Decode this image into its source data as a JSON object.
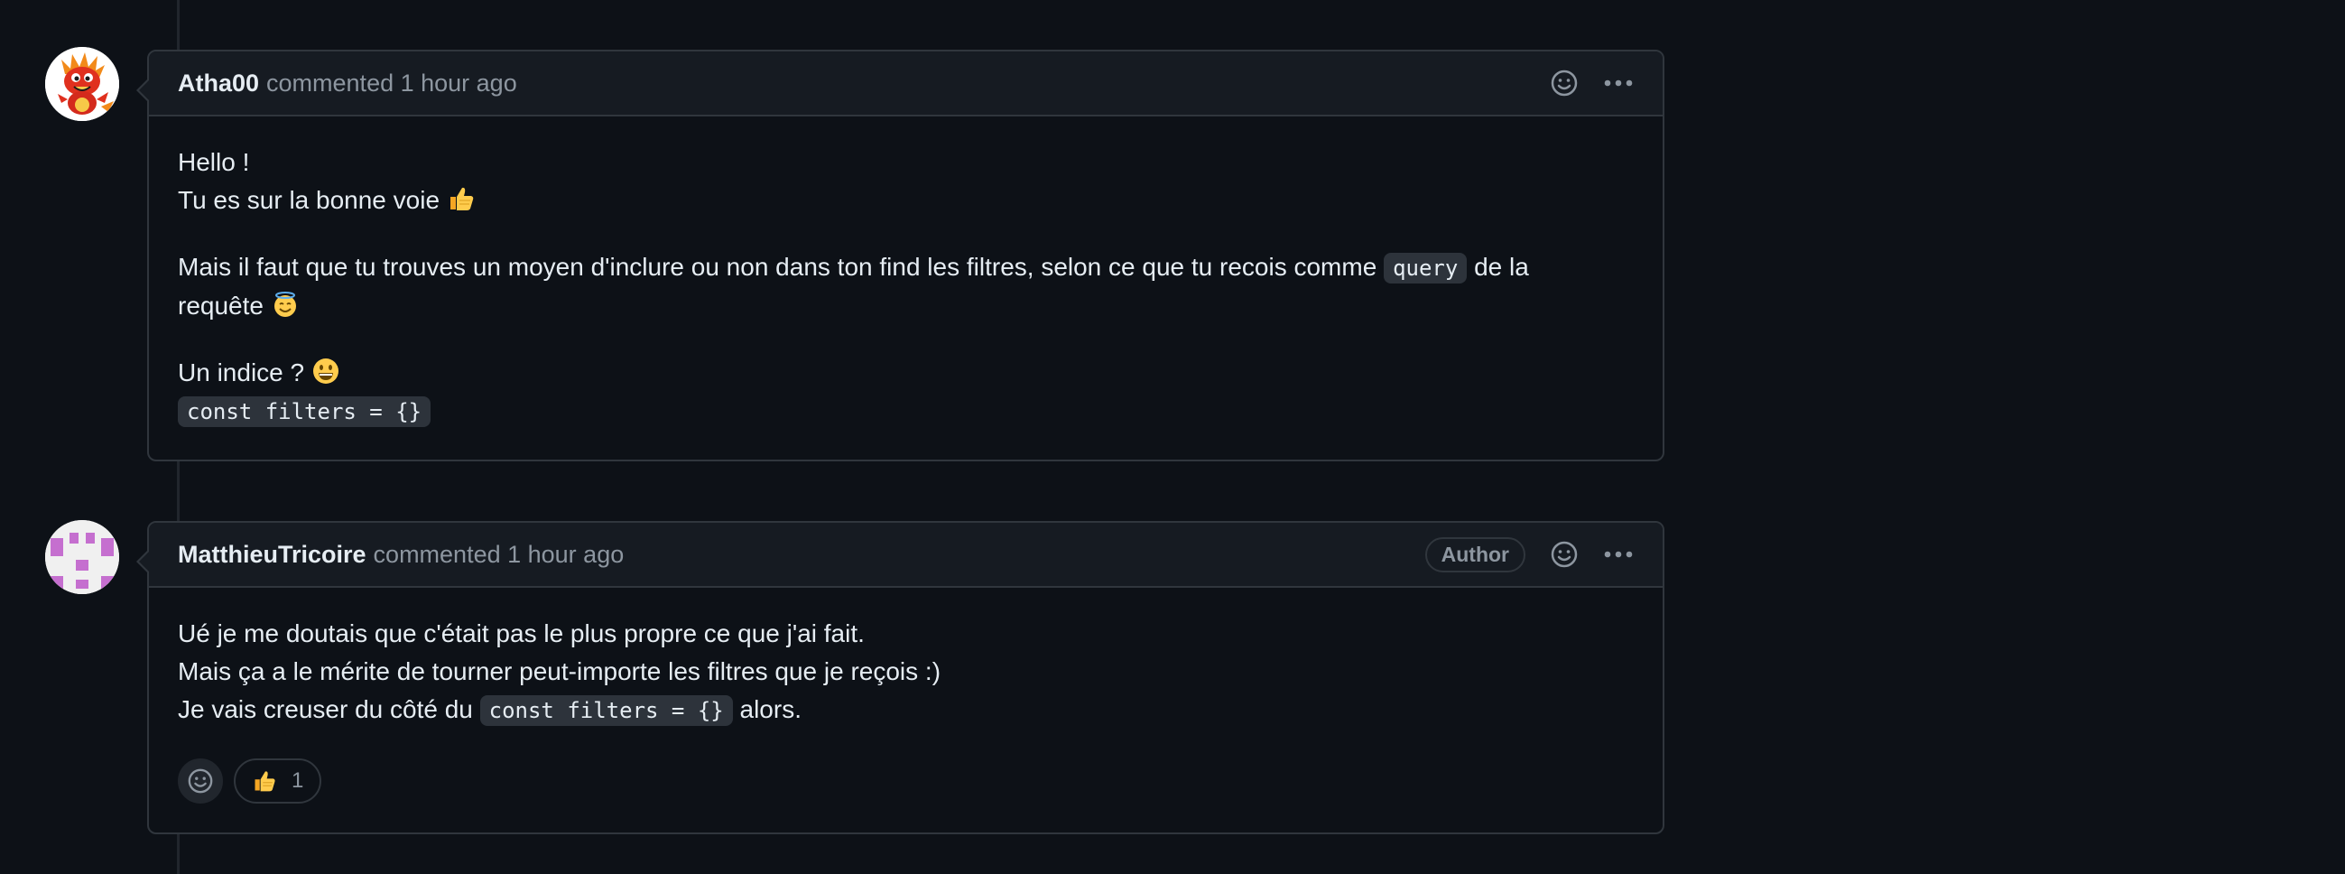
{
  "comments": [
    {
      "author": "Atha00",
      "meta": "commented 1 hour ago",
      "avatar_icon": "dragon-avatar",
      "body": {
        "line1": "Hello !",
        "line2": "Tu es sur la bonne voie",
        "line2_emoji": "thumbs-up-emoji",
        "para2_before": "Mais il faut que tu trouves un moyen d'inclure ou non dans ton find les filtres, selon ce que tu recois comme",
        "para2_code": "query",
        "para2_after": "de la",
        "para2_line2": "requête",
        "para2_emoji": "smiling-face-with-halo-emoji",
        "para3_line1": "Un indice ?",
        "para3_emoji": "grinning-face-emoji",
        "para3_code": "const filters = {}"
      },
      "actions": {
        "react_icon": "smiley-icon",
        "more_icon": "kebab-horizontal-icon"
      }
    },
    {
      "author": "MatthieuTricoire",
      "meta": "commented 1 hour ago",
      "badge": "Author",
      "avatar_icon": "identicon-avatar",
      "body": {
        "line1": "Ué je me doutais que c'était pas le plus propre ce que j'ai fait.",
        "line2": "Mais ça a le mérite de tourner peut-importe les filtres que je reçois :)",
        "line3_before": "Je vais creuser du côté du",
        "line3_code": "const filters = {}",
        "line3_after": "alors."
      },
      "actions": {
        "react_icon": "smiley-icon",
        "more_icon": "kebab-horizontal-icon"
      },
      "reactions": [
        {
          "emoji": "thumbs-up-emoji",
          "count": "1"
        }
      ]
    }
  ],
  "colors": {
    "background": "#0d1117",
    "header_bg": "#161b22",
    "border": "#30363d",
    "muted_text": "#8d96a0",
    "text": "#e6edf3",
    "code_bg": "#2d333b",
    "identicon": "#c56fcf"
  }
}
